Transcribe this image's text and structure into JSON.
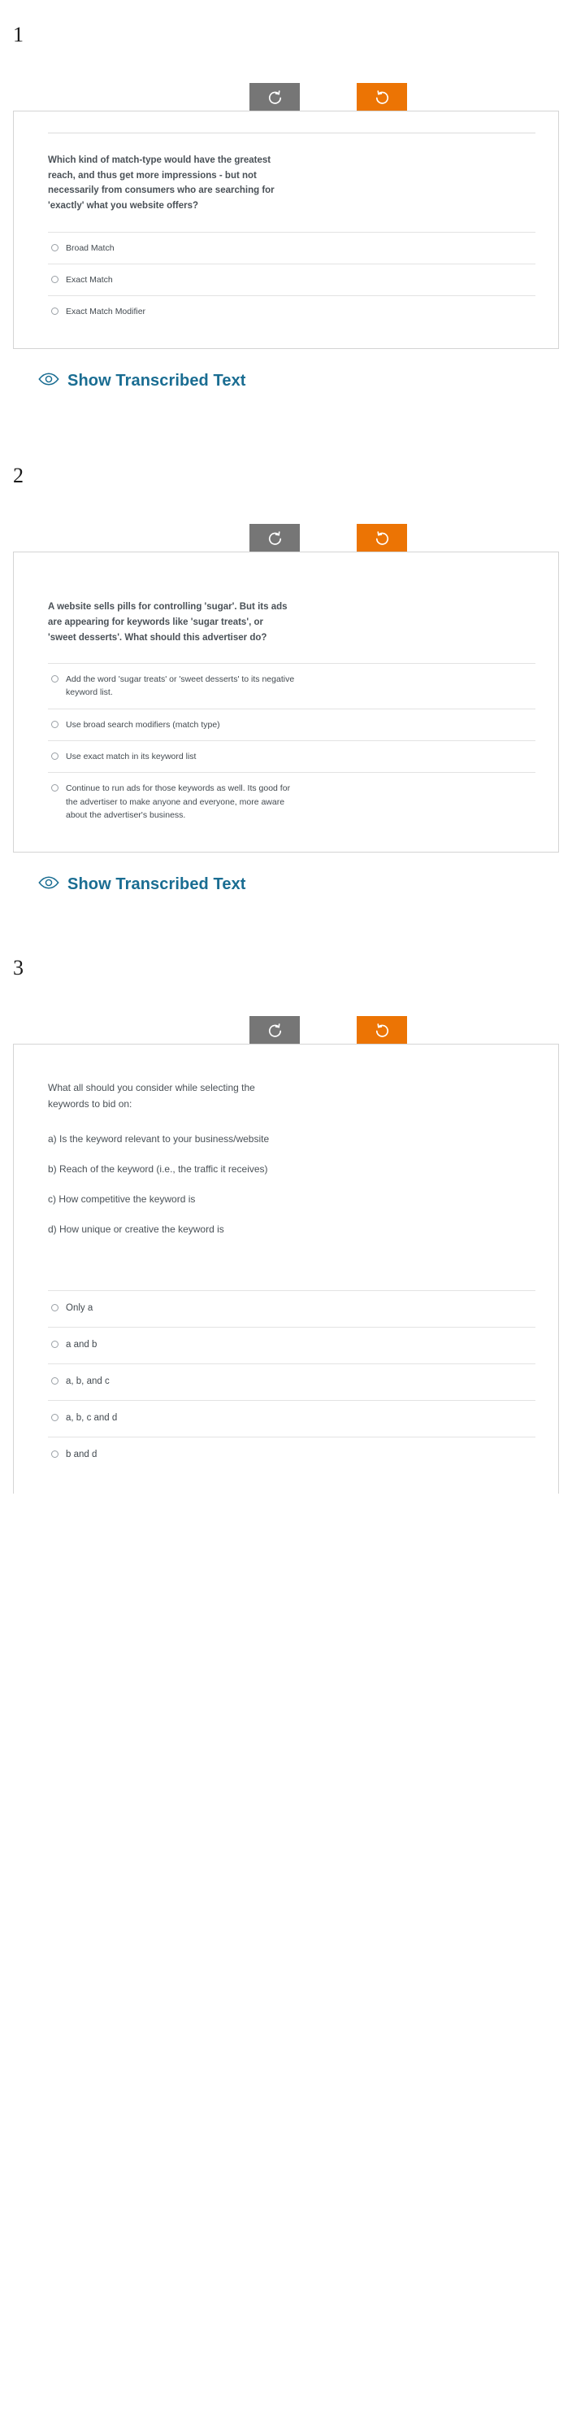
{
  "page": {
    "background": "#ffffff",
    "accent_orange": "#ec7404",
    "accent_gray": "#767676",
    "link_color": "#1a6d92",
    "text_color": "#4a5157"
  },
  "controls": {
    "rotate_ccw": {
      "icon": "rotate-counterclockwise-icon",
      "label": "",
      "color": "#767676"
    },
    "rotate_cw": {
      "icon": "rotate-clockwise-icon",
      "label": "",
      "color": "#ec7404"
    }
  },
  "transcribe_link": {
    "icon": "eye-icon",
    "label": "Show Transcribed Text"
  },
  "questions": [
    {
      "number": "1",
      "prompt": "Which kind of match-type would have the greatest reach, and thus get more impressions - but not necessarily from consumers who are searching for 'exactly' what you website offers?",
      "sub_items": [],
      "options": [
        "Broad Match",
        "Exact Match",
        "Exact Match Modifier"
      ]
    },
    {
      "number": "2",
      "prompt": "A website sells pills for controlling 'sugar'. But its ads are appearing for keywords like 'sugar treats', or 'sweet desserts'. What should this advertiser do?",
      "sub_items": [],
      "options": [
        "Add the word 'sugar treats' or 'sweet desserts' to its negative keyword list.",
        "Use broad search modifiers (match type)",
        "Use exact match in its keyword list",
        "Continue to run ads for those keywords as well. Its good for the advertiser to make anyone and everyone, more aware about the advertiser's business."
      ]
    },
    {
      "number": "3",
      "prompt": "What all should you consider while selecting the keywords to bid on:",
      "sub_items": [
        "a) Is the keyword relevant to your business/website",
        "b) Reach of the keyword  (i.e., the traffic it receives)",
        "c) How competitive the keyword is",
        "d) How unique or creative the keyword is"
      ],
      "options": [
        "Only a",
        "a and b",
        "a, b, and c",
        "a, b, c and d",
        "b and d"
      ]
    }
  ]
}
